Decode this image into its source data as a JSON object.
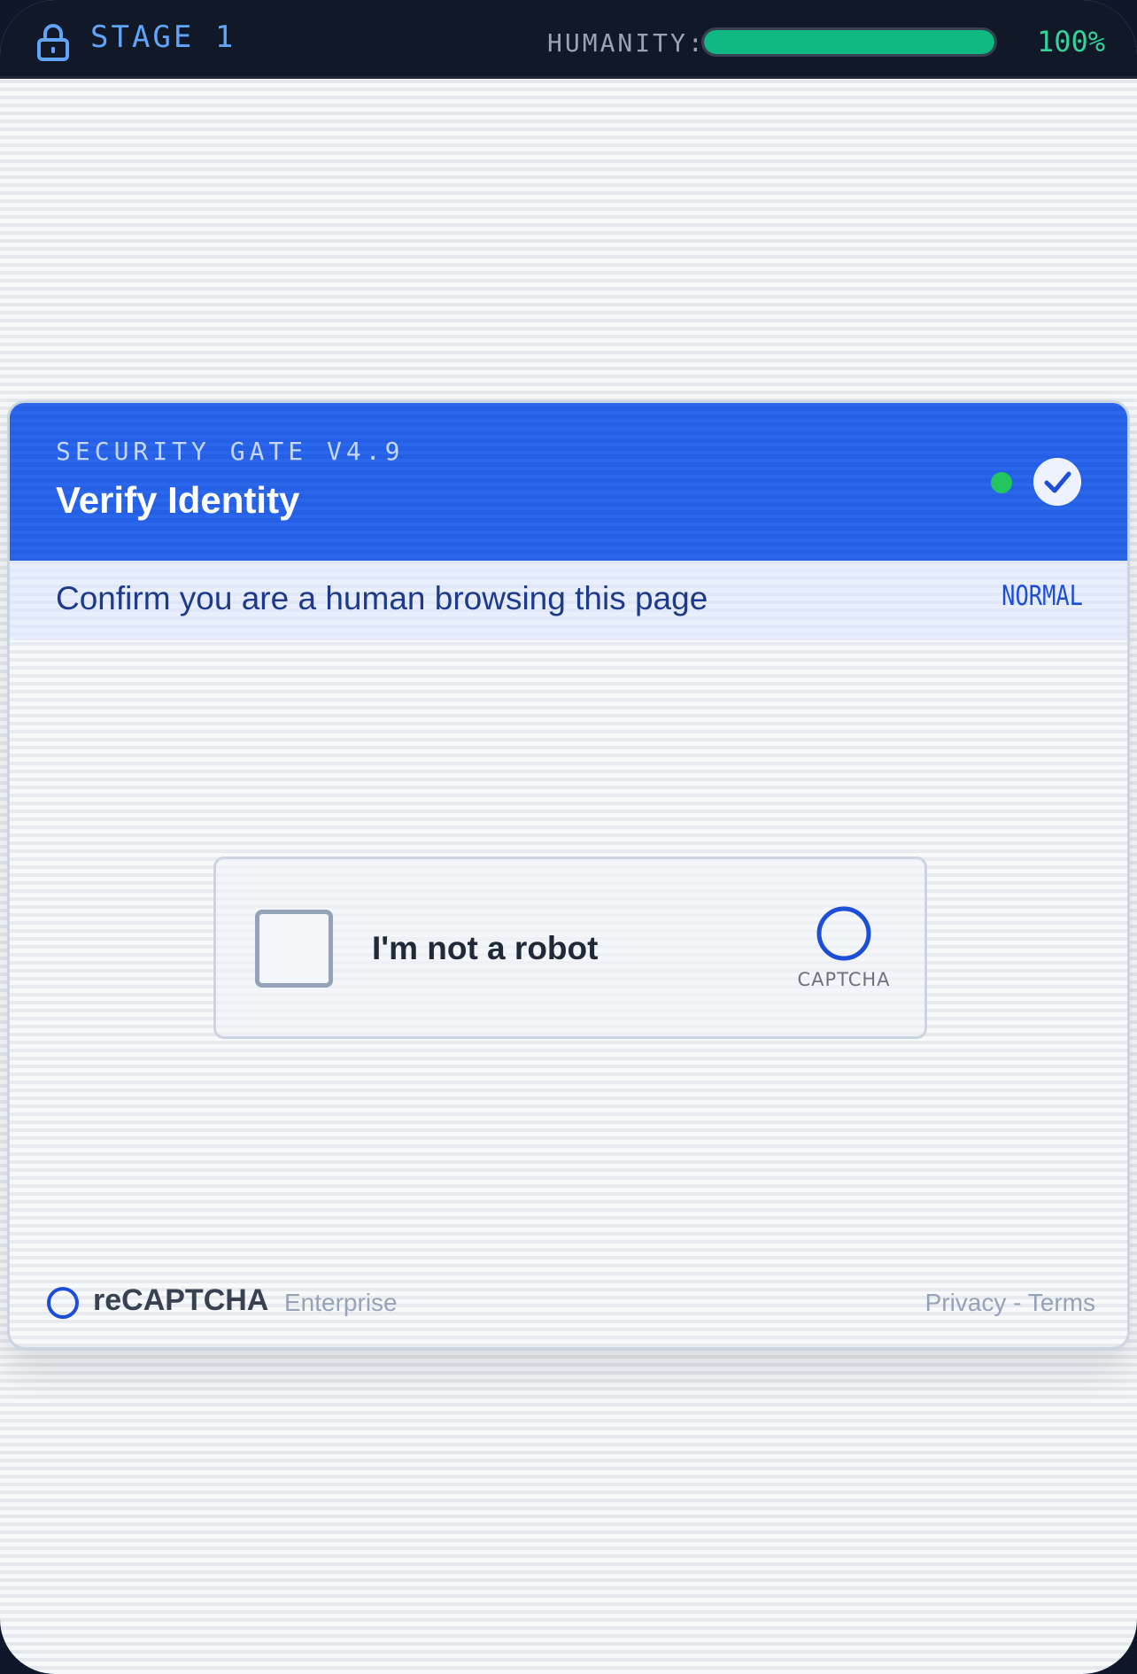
{
  "topbar": {
    "stage_label": "STAGE 1",
    "humanity_label": "HUMANITY:",
    "humanity_percent": 100,
    "humanity_value": "100%",
    "lock_icon": "lock-icon"
  },
  "card": {
    "version_label": "SECURITY GATE V4.9",
    "title": "Verify Identity",
    "status_icon": "check-circle-icon",
    "subtitle": "Confirm you are a human browsing this page",
    "difficulty": "NORMAL"
  },
  "challenge": {
    "checkbox_label": "I'm not a robot",
    "checked": false,
    "logo_caption": "CAPTCHA"
  },
  "footer": {
    "brand": "reCAPTCHA",
    "edition": "Enterprise",
    "privacy_label": "Privacy",
    "separator": " - ",
    "terms_label": "Terms"
  },
  "colors": {
    "accent": "#2563eb",
    "success": "#10b981",
    "topbar_bg": "#111827",
    "stage_text": "#60a5fa"
  }
}
